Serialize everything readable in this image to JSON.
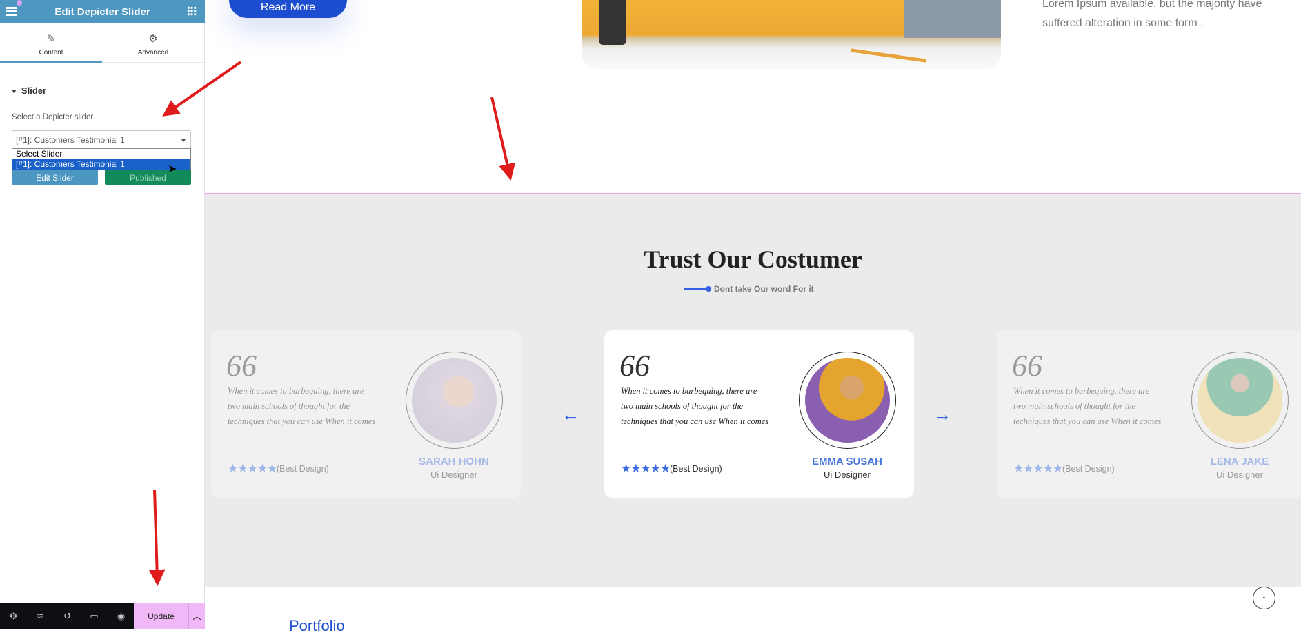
{
  "sidebar": {
    "title": "Edit Depicter Slider",
    "tabs": [
      {
        "label": "Content",
        "icon": "pencil-icon"
      },
      {
        "label": "Advanced",
        "icon": "gear-icon"
      }
    ],
    "section_title": "Slider",
    "select_label": "Select a Depicter slider",
    "select_value": "[#1]: Customers Testimonial 1",
    "dropdown_options": [
      "Select Slider",
      "[#1]: Customers Testimonial 1"
    ],
    "edit_button": "Edit Slider",
    "published_button": "Published",
    "footer": {
      "icons": [
        "gear-icon",
        "layers-icon",
        "history-icon",
        "responsive-icon",
        "eye-icon"
      ],
      "update_label": "Update"
    }
  },
  "page": {
    "read_more": "Read More",
    "intro_lines": [
      "Lorem Ipsum available, but the majority have",
      "suffered alteration in some form ."
    ],
    "section_title": "Trust Our Costumer",
    "section_subtitle": "Dont take Our word For it",
    "testimonials": [
      {
        "quote": "When it comes to barbequing, there are two main schools of thought for the techniques that you can use When it comes",
        "stars": 5,
        "rating_label": "(Best Design)",
        "name": "SARAH HOHN",
        "role": "Ui Designer",
        "active": false
      },
      {
        "quote": "When it comes to barbequing, there are two main schools of thought for the techniques that you can use When it comes",
        "stars": 5,
        "rating_label": "(Best Design)",
        "name": "EMMA SUSAH",
        "role": "Ui Designer",
        "active": true
      },
      {
        "quote": "When it comes to barbequing, there are two main schools of thought for the techniques that you can use When it comes",
        "stars": 5,
        "rating_label": "(Best Design)",
        "name": "LENA JAKE",
        "role": "Ui Designer",
        "active": false
      }
    ],
    "next_section_title": "Portfolio"
  },
  "colors": {
    "editor_header": "#4d97c0",
    "update_button": "#f1b8f8",
    "accent_blue": "#1d4ed0",
    "annotation_red": "#e01b1b"
  }
}
